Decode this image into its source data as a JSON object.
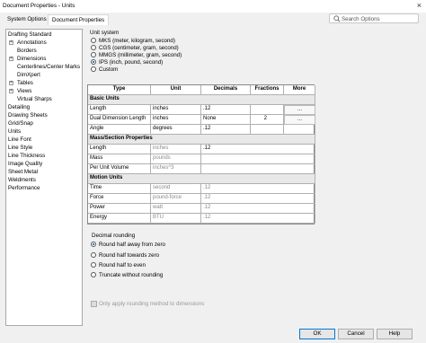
{
  "window": {
    "title": "Document Properties - Units",
    "close_glyph": "×"
  },
  "tabs": [
    "System Options",
    "Document Properties"
  ],
  "search": {
    "placeholder": "Search Options"
  },
  "tree": [
    "Drafting Standard",
    "Annotations",
    "Borders",
    "Dimensions",
    "Centerlines/Center Marks",
    "DimXpert",
    "Tables",
    "Views",
    "Virtual Sharps",
    "Detailing",
    "Drawing Sheets",
    "Grid/Snap",
    "Units",
    "Line Font",
    "Line Style",
    "Line Thickness",
    "Image Quality",
    "Sheet Metal",
    "Weldments",
    "Performance"
  ],
  "unit_system": {
    "label": "Unit system",
    "options": [
      "MKS  (meter, kilogram, second)",
      "CGS  (centimeter, gram, second)",
      "MMGS (millimeter, gram, second)",
      "IPS  (inch, pound, second)",
      "Custom"
    ],
    "selected_index": 3
  },
  "table": {
    "headers": [
      "Type",
      "Unit",
      "Decimals",
      "Fractions",
      "More"
    ],
    "sections": {
      "basic": "Basic Units",
      "mass": "Mass/Section Properties",
      "motion": "Motion Units"
    },
    "basic_rows": [
      [
        "Length",
        "inches",
        ".12",
        "",
        "..."
      ],
      [
        "Dual Dimension Length",
        "inches",
        "None",
        "2",
        "..."
      ],
      [
        "Angle",
        "degrees",
        ".12",
        "",
        ""
      ]
    ],
    "mass_rows": [
      [
        "Length",
        "inches",
        ".12"
      ],
      [
        "Mass",
        "pounds",
        ""
      ],
      [
        "Per Unit Volume",
        "inches^3",
        ""
      ]
    ],
    "motion_rows": [
      [
        "Time",
        "second",
        ".12"
      ],
      [
        "Force",
        "pound-force",
        ".12"
      ],
      [
        "Power",
        "watt",
        ".12"
      ],
      [
        "Energy",
        "BTU",
        ".12"
      ]
    ]
  },
  "rounding": {
    "label": "Decimal rounding",
    "options": [
      "Round half away from zero",
      "Round half towards zero",
      "Round half to even",
      "Truncate without rounding"
    ],
    "selected_index": 0
  },
  "only_apply": "Only apply rounding method to dimensions",
  "buttons": {
    "ok": "OK",
    "cancel": "Cancel",
    "help": "Help"
  }
}
